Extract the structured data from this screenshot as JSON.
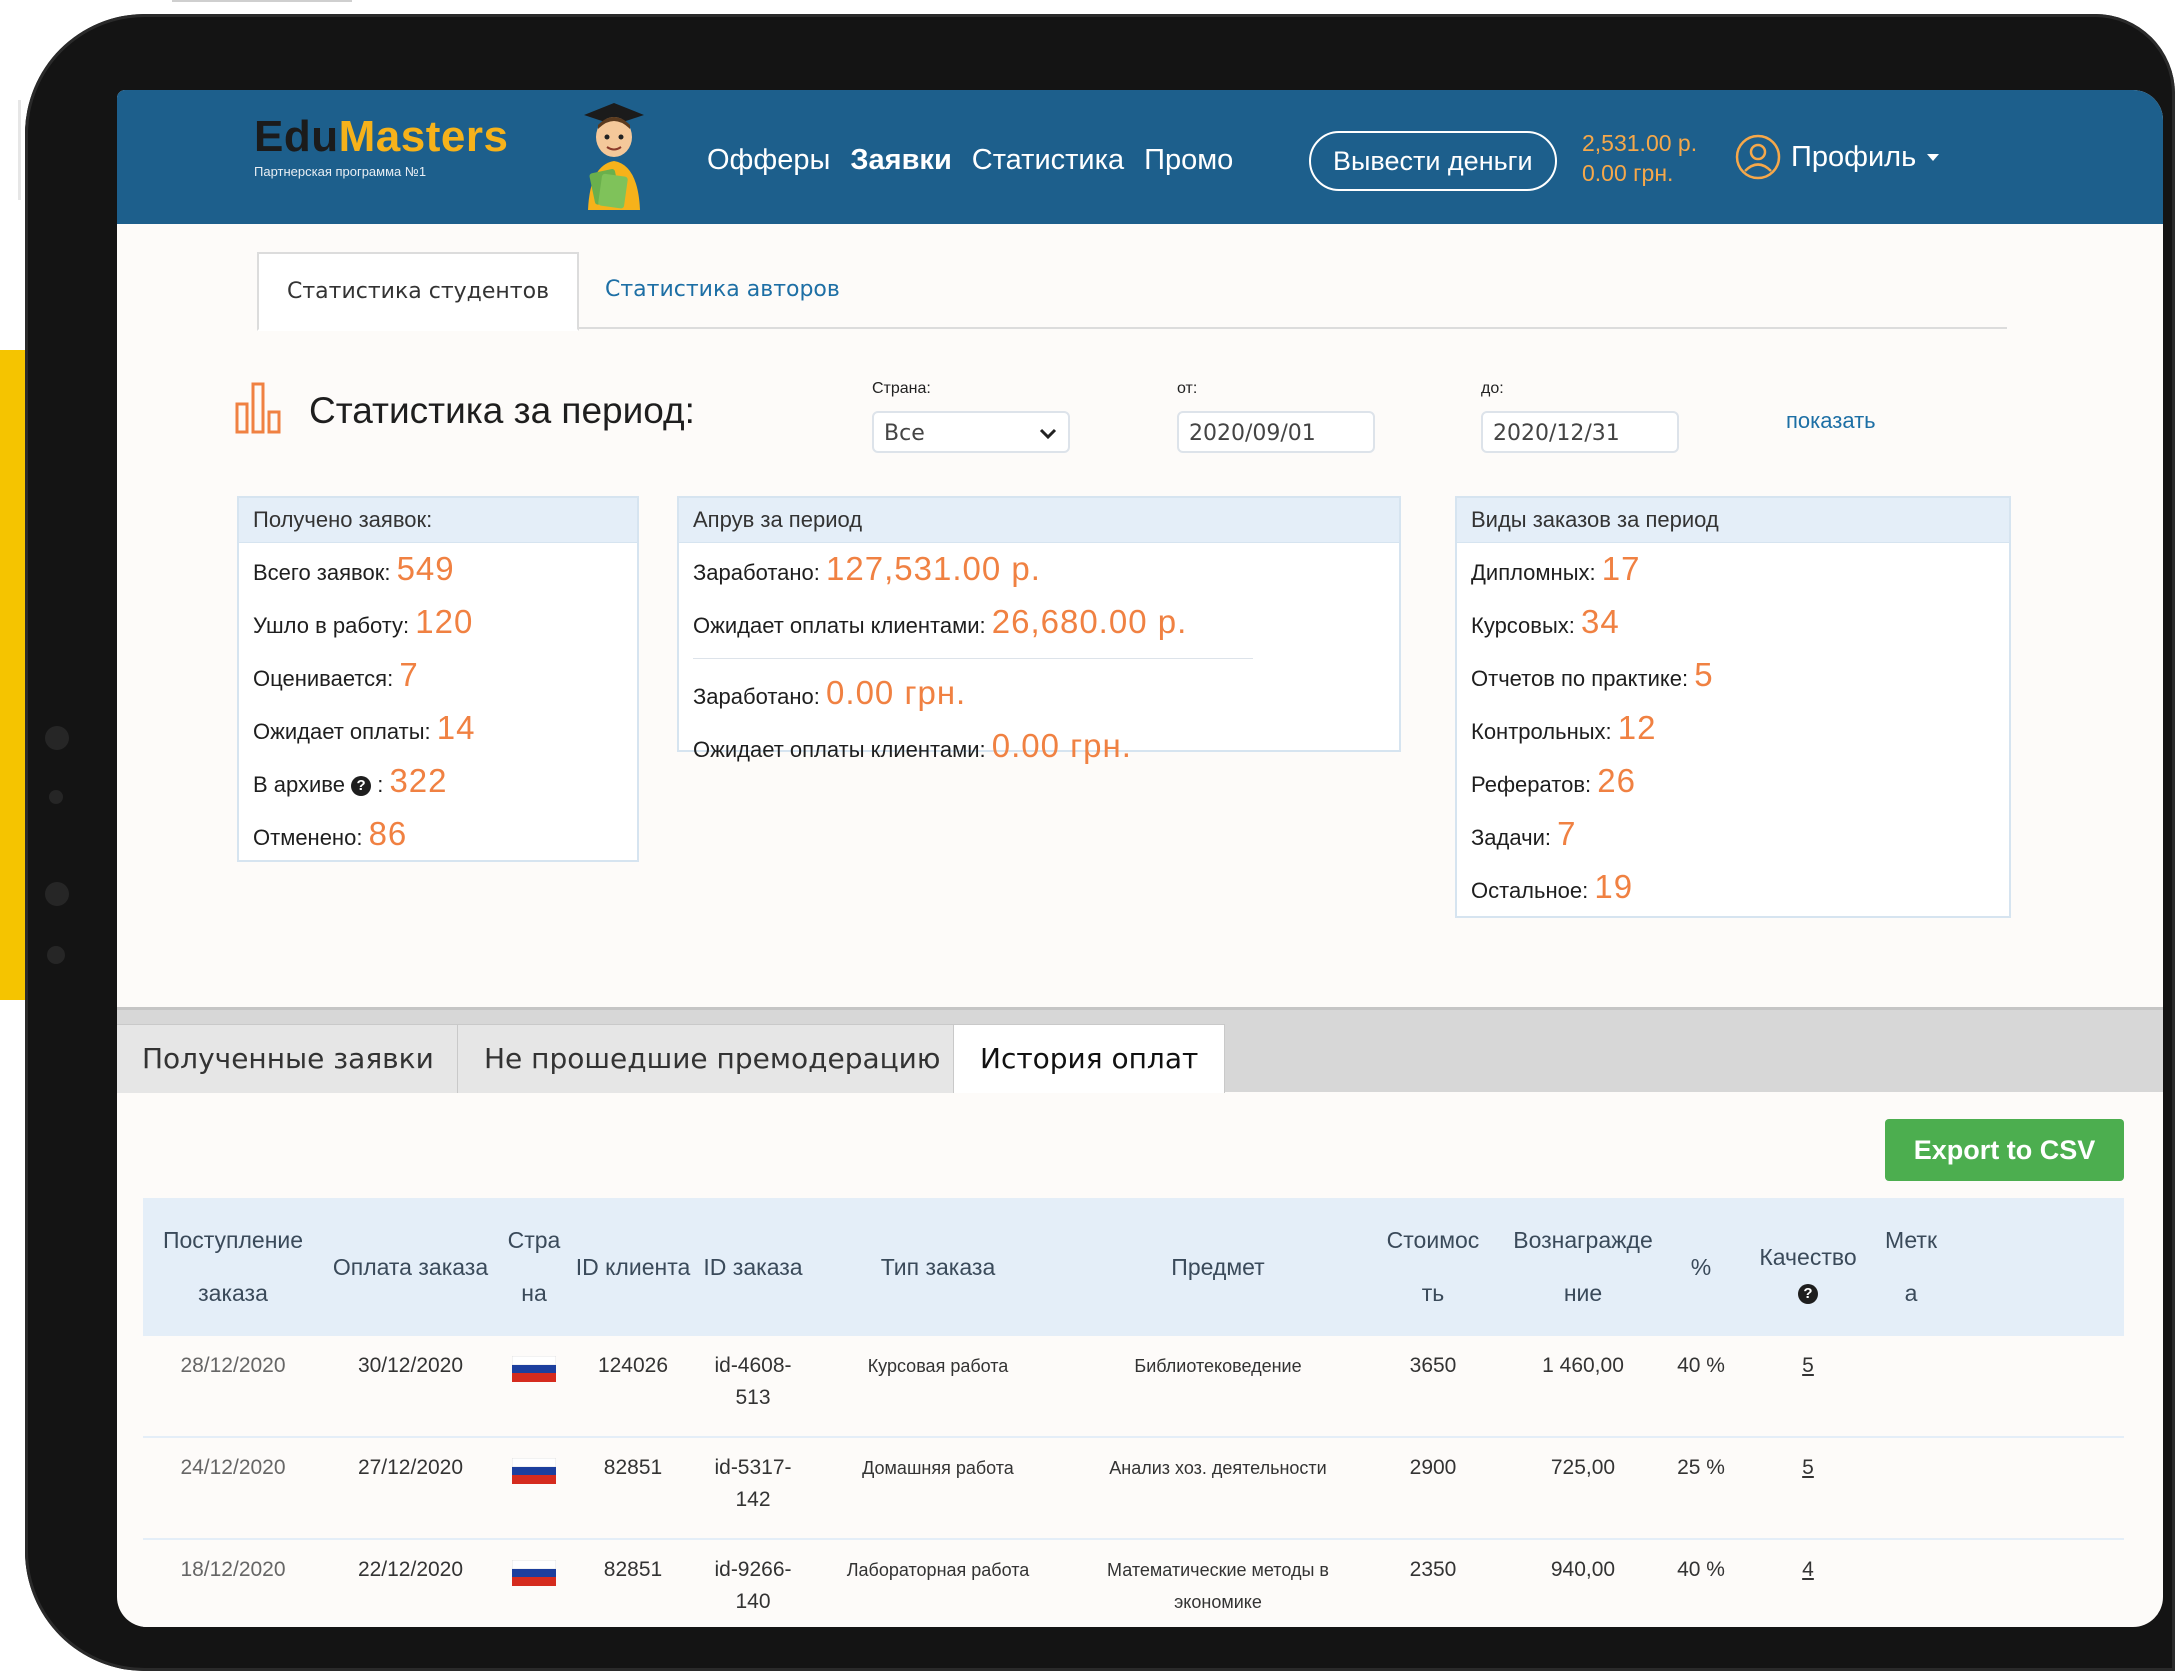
{
  "header": {
    "logo_edu": "Edu",
    "logo_masters": "Masters",
    "logo_sub": "Партнерская программа №1",
    "nav": [
      "Офферы",
      "Заявки",
      "Статистика",
      "Промо"
    ],
    "withdraw_label": "Вывести деньги",
    "balance_rub": "2,531.00 р.",
    "balance_uah": "0.00 грн.",
    "profile_label": "Профиль"
  },
  "top_tabs": [
    "Статистика студентов",
    "Статистика авторов"
  ],
  "period": {
    "title": "Статистика за период:",
    "country_label": "Страна:",
    "country_value": "Все",
    "from_label": "от:",
    "from_value": "2020/09/01",
    "to_label": "до:",
    "to_value": "2020/12/31",
    "show_label": "показать"
  },
  "received": {
    "title": "Получено заявок:",
    "rows": [
      {
        "label": "Всего заявок:",
        "value": "549"
      },
      {
        "label": "Ушло в работу:",
        "value": "120"
      },
      {
        "label": "Оценивается:",
        "value": "7"
      },
      {
        "label": "Ожидает оплаты:",
        "value": "14"
      },
      {
        "label": "В архиве",
        "value": "322"
      },
      {
        "label": "Отменено:",
        "value": "86"
      }
    ]
  },
  "approve": {
    "title": "Апрув за период",
    "rows": [
      {
        "label": "Заработано:",
        "value": "127,531.00 р."
      },
      {
        "label": "Ожидает оплаты клиентами:",
        "value": "26,680.00 р."
      },
      {
        "label": "Заработано:",
        "value": "0.00 грн."
      },
      {
        "label": "Ожидает оплаты клиентами:",
        "value": "0.00 грн."
      }
    ]
  },
  "types": {
    "title": "Виды заказов за период",
    "rows": [
      {
        "label": "Дипломных:",
        "value": "17"
      },
      {
        "label": "Курсовых:",
        "value": "34"
      },
      {
        "label": "Отчетов по практике:",
        "value": "5"
      },
      {
        "label": "Контрольных:",
        "value": "12"
      },
      {
        "label": "Рефератов:",
        "value": "26"
      },
      {
        "label": "Задачи:",
        "value": "7"
      },
      {
        "label": "Остальное:",
        "value": "19"
      }
    ]
  },
  "bottom_tabs": [
    "Полученные заявки",
    "Не прошедшие премодерацию",
    "История оплат"
  ],
  "export_label": "Export to CSV",
  "table": {
    "headers": [
      "Поступление заказа",
      "Оплата заказа",
      "Стра на",
      "ID клиента",
      "ID заказа",
      "Тип заказа",
      "Предмет",
      "Стоимос ть",
      "Вознагражде ние",
      "%",
      "Качество",
      "Метк а"
    ],
    "rows": [
      {
        "received": "28/12/2020",
        "paid": "30/12/2020",
        "client": "124026",
        "order": "id-4608-513",
        "type": "Курсовая работа",
        "subject": "Библиотековедение",
        "cost": "3650",
        "reward": "1 460,00",
        "percent": "40 %",
        "quality": "5"
      },
      {
        "received": "24/12/2020",
        "paid": "27/12/2020",
        "client": "82851",
        "order": "id-5317-142",
        "type": "Домашняя работа",
        "subject": "Анализ хоз. деятельности",
        "cost": "2900",
        "reward": "725,00",
        "percent": "25 %",
        "quality": "5"
      },
      {
        "received": "18/12/2020",
        "paid": "22/12/2020",
        "client": "82851",
        "order": "id-9266-140",
        "type": "Лабораторная работа",
        "subject": "Математические методы в экономике",
        "cost": "2350",
        "reward": "940,00",
        "percent": "40 %",
        "quality": "4"
      }
    ]
  },
  "colors": {
    "header_bg": "#1d5f8c",
    "accent_orange": "#f08142",
    "link_blue": "#1d6fa5",
    "export_green": "#4cae4f",
    "panel_head": "#e4eef8"
  }
}
